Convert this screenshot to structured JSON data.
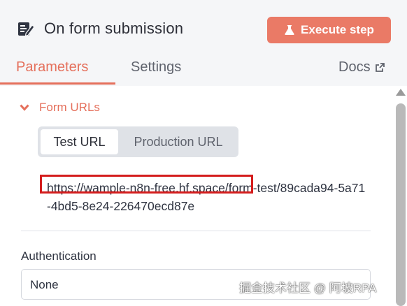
{
  "header": {
    "title": "On form submission",
    "node_icon": "form-edit-icon",
    "execute_label": "Execute step",
    "execute_icon": "flask-icon",
    "accent_color": "#ea7a66"
  },
  "tabs": [
    {
      "label": "Parameters",
      "active": true
    },
    {
      "label": "Settings",
      "active": false
    },
    {
      "label": "Docs",
      "icon": "external-link-icon",
      "active": false
    }
  ],
  "form_urls": {
    "section_label": "Form URLs",
    "toggle_icon": "chevron-down-icon",
    "url_options": [
      "Test URL",
      "Production URL"
    ],
    "selected_option": "Test URL",
    "url_highlight": "https://wample-n8n-free.hf.space",
    "url_rest": "/form-test/89cada94-5a71-4bd5-8e24-226470ecd87e"
  },
  "authentication": {
    "label": "Authentication",
    "value": "None"
  },
  "watermark": "掘金技术社区 @ 阿坡RPA"
}
